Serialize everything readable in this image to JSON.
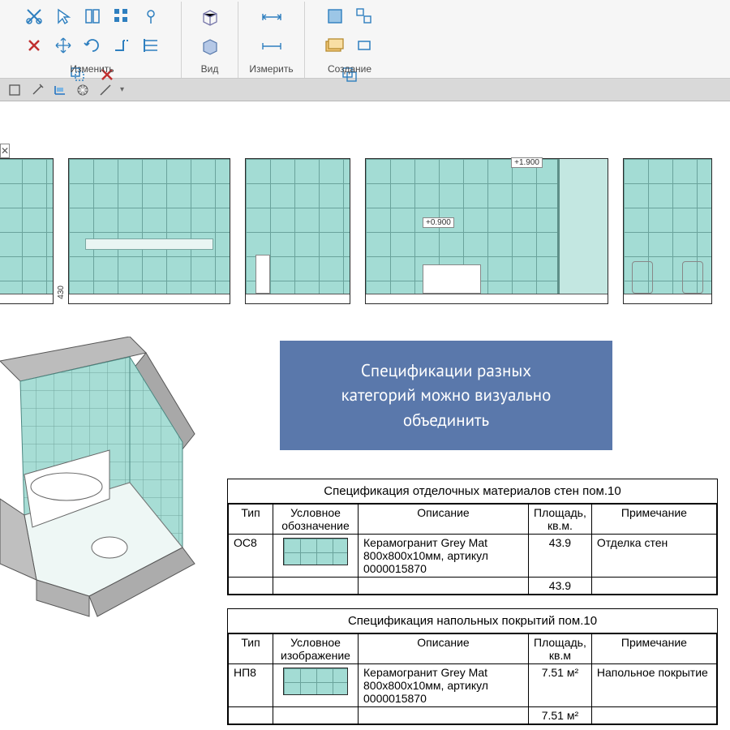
{
  "ribbon": {
    "groups": {
      "modify": {
        "label": "Изменить"
      },
      "view": {
        "label": "Вид"
      },
      "measure": {
        "label": "Измерить"
      },
      "create": {
        "label": "Создание"
      }
    }
  },
  "callout": {
    "line1": "Спецификации разных",
    "line2": "категорий можно визуально",
    "line3": "объединить"
  },
  "dims": {
    "d430": "430",
    "d0900": "+0.900",
    "d1900": "+1.900"
  },
  "spec_walls": {
    "title": "Спецификация отделочных материалов стен пом.10",
    "headers": {
      "type": "Тип",
      "symbol": "Условное обозначение",
      "desc": "Описание",
      "area": "Площадь, кв.м.",
      "note": "Примечание"
    },
    "row": {
      "type": "ОС8",
      "desc": "Керамогранит Grey Mat 800х800х10мм, артикул 0000015870",
      "area": "43.9",
      "note": "Отделка стен"
    },
    "total": "43.9"
  },
  "spec_floor": {
    "title": "Спецификация напольных покрытий пом.10",
    "headers": {
      "type": "Тип",
      "symbol": "Условное изображение",
      "desc": "Описание",
      "area": "Площадь, кв.м",
      "note": "Примечание"
    },
    "row": {
      "type": "НП8",
      "desc": "Керамогранит Grey Mat 800х800х10мм, артикул 0000015870",
      "area": "7.51 м²",
      "note": "Напольное покрытие"
    },
    "total": "7.51 м²"
  }
}
